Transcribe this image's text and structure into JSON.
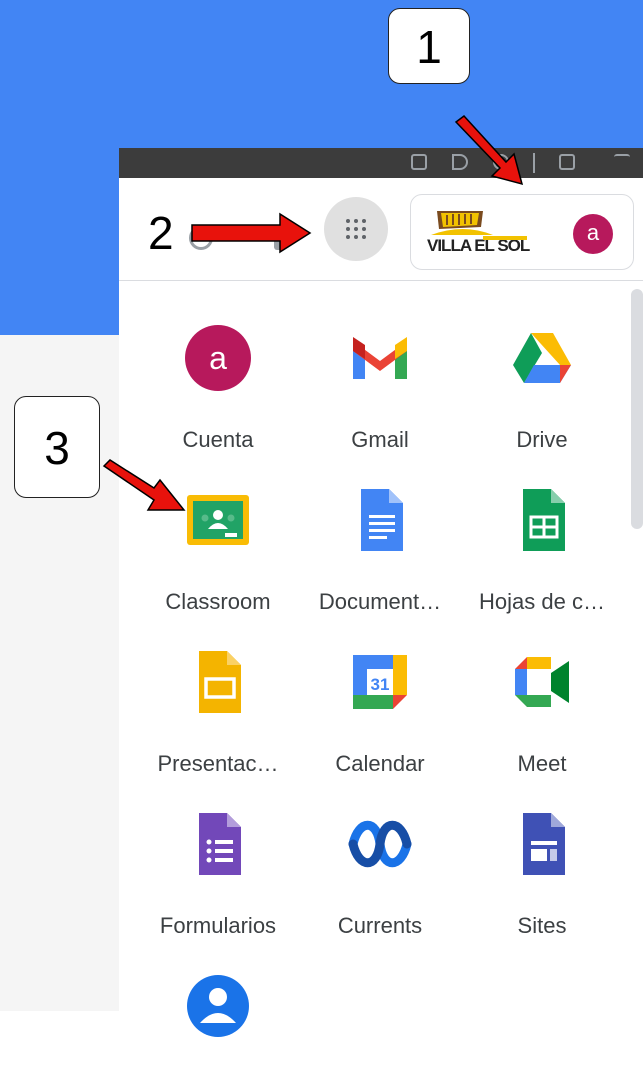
{
  "steps": {
    "one": "1",
    "two": "2",
    "three": "3"
  },
  "account": {
    "avatar_letter": "a",
    "org_logo_text": "VILLA EL SOL"
  },
  "apps": [
    {
      "label": "Cuenta",
      "icon": "account-icon"
    },
    {
      "label": "Gmail",
      "icon": "gmail-icon"
    },
    {
      "label": "Drive",
      "icon": "drive-icon"
    },
    {
      "label": "Classroom",
      "icon": "classroom-icon"
    },
    {
      "label": "Document…",
      "icon": "docs-icon"
    },
    {
      "label": "Hojas de c…",
      "icon": "sheets-icon"
    },
    {
      "label": "Presentac…",
      "icon": "slides-icon"
    },
    {
      "label": "Calendar",
      "icon": "calendar-icon"
    },
    {
      "label": "Meet",
      "icon": "meet-icon"
    },
    {
      "label": "Formularios",
      "icon": "forms-icon"
    },
    {
      "label": "Currents",
      "icon": "currents-icon"
    },
    {
      "label": "Sites",
      "icon": "sites-icon"
    },
    {
      "label": "",
      "icon": "contacts-icon"
    }
  ],
  "calendar_day": "31",
  "colors": {
    "slide_blue": "#4285f4",
    "avatar": "#b7195c",
    "arrow_red": "#e8120c"
  }
}
